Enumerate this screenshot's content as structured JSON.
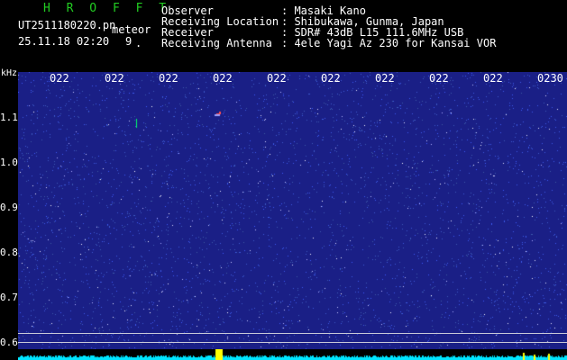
{
  "header": {
    "brand": "H R O F F T",
    "filename": "UT2511180220.pn",
    "meteor_label": "meteor",
    "datetime": "25.11.18 02:20",
    "count": "9",
    "dot": "."
  },
  "info": {
    "labels": [
      "Observer",
      "Receiving Location",
      "Receiver",
      "Receiving Antenna"
    ],
    "values": [
      ": Masaki Kano",
      ": Shibukawa, Gunma, Japan",
      ": SDR# 43dB L15 111.6MHz USB",
      ": 4ele Yagi Az 230 for Kansai VOR"
    ]
  },
  "axis": {
    "unit": "kHz",
    "y_ticks": [
      "1.1",
      "1.0",
      "0.9",
      "0.8",
      "0.7",
      "0.6"
    ],
    "x_ticks": [
      "022",
      "022",
      "022",
      "022",
      "022",
      "022",
      "022",
      "022",
      "022",
      "0230"
    ]
  },
  "colors": {
    "background": "#000000",
    "plot_bg": "#1a1f86",
    "brand": "#22cc22",
    "spectrum": "#00e5ff",
    "spectrum_peak": "#ffff00"
  }
}
